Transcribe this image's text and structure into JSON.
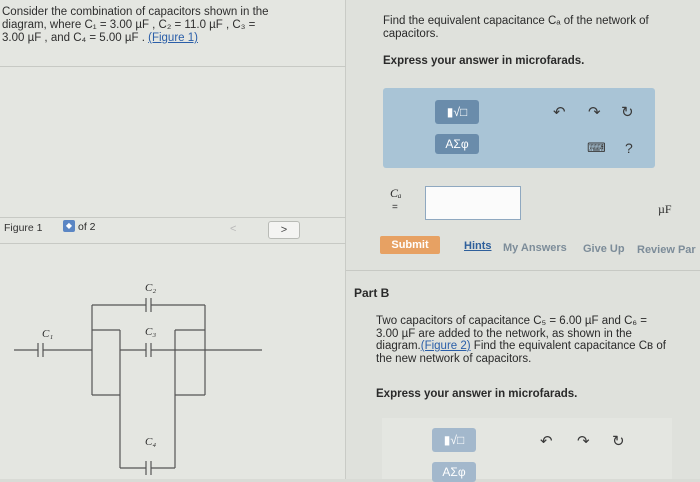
{
  "problem": {
    "line1": "Consider the combination of capacitors shown in the",
    "line2": "diagram, where C₁ = 3.00 µF , C₂ = 11.0 µF , C₃ =",
    "line3a": "3.00 µF , and C₄ = 5.00 µF . ",
    "figure_link": "(Figure 1)"
  },
  "figure_nav": {
    "label": "Figure 1",
    "of": "of 2",
    "prev": "<",
    "next": ">"
  },
  "diagram": {
    "labels": {
      "c1": "C₁",
      "c2": "C₂",
      "c3": "C₃",
      "c4": "C₄"
    }
  },
  "part_a": {
    "question_line1": "Find the equivalent capacitance Cₐ of the network of",
    "question_line2": "capacitors.",
    "instruction": "Express your answer in microfarads.",
    "toolbar": {
      "template_btn": "▮√□",
      "greek_btn": "ΑΣφ",
      "undo_icon": "↶",
      "redo_icon": "↷",
      "reset_icon": "↻",
      "keyboard_icon": "⌨",
      "help_icon": "?"
    },
    "equation_label": "Cₐ",
    "equals": "=",
    "input_value": "",
    "unit": "µF",
    "submit": "Submit",
    "hints": "Hints",
    "my_answers": "My Answers",
    "give_up": "Give Up",
    "review": "Review Par"
  },
  "part_b": {
    "title": "Part B",
    "line1": "Two capacitors of capacitance C₅ = 6.00 µF and C₆ =",
    "line2": "3.00 µF are added to the network, as shown in the",
    "line3a": "diagram.",
    "figure_link": "(Figure 2)",
    "line3b": " Find the equivalent capacitance Cʙ of",
    "line4": "the new network of capacitors.",
    "instruction": "Express your answer in microfarads.",
    "toolbar": {
      "template_btn": "▮√□",
      "greek_btn": "ΑΣφ",
      "undo_icon": "↶",
      "redo_icon": "↷",
      "reset_icon": "↻"
    }
  }
}
